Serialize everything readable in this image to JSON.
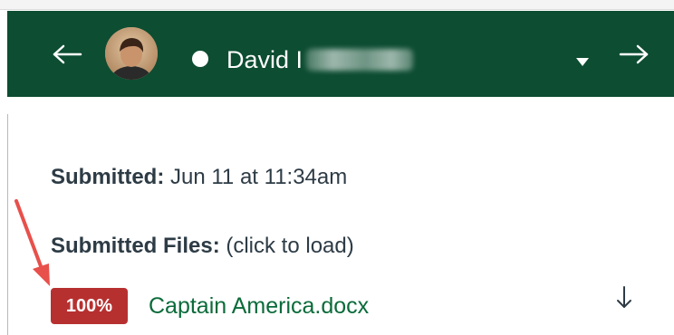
{
  "header": {
    "prev_icon": "arrow-left-icon",
    "next_icon": "arrow-right-icon",
    "avatar_icon": "student-avatar",
    "status_icon": "white-dot-icon",
    "student_name": "David I",
    "dropdown_icon": "caret-down-icon",
    "background_color": "#0d4d32"
  },
  "submission": {
    "submitted_label": "Submitted:",
    "submitted_value": "Jun 11 at 11:34am",
    "files_label": "Submitted Files:",
    "files_hint": "(click to load)",
    "files": [
      {
        "score": "100%",
        "name": "Captain America.docx",
        "download_icon": "download-arrow-icon"
      }
    ]
  },
  "colors": {
    "badge": "#b73030",
    "link": "#0b6b3a",
    "annotation_arrow": "#e8504b"
  }
}
